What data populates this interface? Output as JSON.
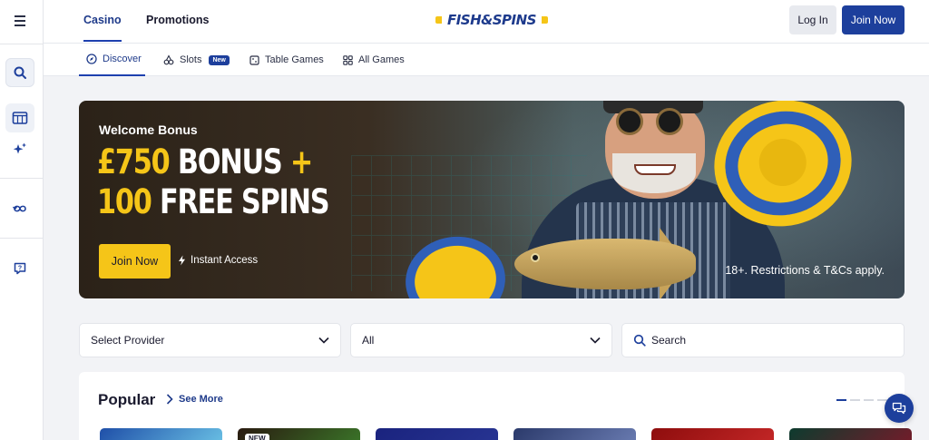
{
  "header": {
    "tabs": [
      {
        "label": "Casino",
        "active": true
      },
      {
        "label": "Promotions",
        "active": false
      }
    ],
    "logo_text": "FISH&SPINS",
    "login_label": "Log In",
    "join_label": "Join Now"
  },
  "subnav": {
    "items": [
      {
        "label": "Discover",
        "icon": "compass-icon",
        "active": true
      },
      {
        "label": "Slots",
        "icon": "cherries-icon",
        "badge": "New"
      },
      {
        "label": "Table Games",
        "icon": "table-icon"
      },
      {
        "label": "All Games",
        "icon": "grid-icon"
      }
    ]
  },
  "sidebar": {
    "icons": [
      "menu-icon",
      "search-icon",
      "slot-machine-icon",
      "sparkle-icon",
      "loop-icon",
      "help-icon"
    ]
  },
  "banner": {
    "eyebrow": "Welcome Bonus",
    "line1_gold": "£750",
    "line1_white": "BONUS",
    "line1_plus": "+",
    "line2_gold": "100",
    "line2_white": "FREE SPINS",
    "cta_label": "Join Now",
    "instant_label": "Instant Access",
    "terms": "18+. Restrictions & T&Cs apply."
  },
  "filters": {
    "provider_value": "Select Provider",
    "category_value": "All",
    "search_placeholder": "Search"
  },
  "popular": {
    "title": "Popular",
    "see_more": "See More",
    "carousel_page": 1,
    "carousel_pages": 4,
    "thumbnails": [
      {
        "colors": [
          "#1f4fa8",
          "#6ec7e8"
        ],
        "badge": ""
      },
      {
        "colors": [
          "#2a1a10",
          "#3b7a2a"
        ],
        "badge": "NEW"
      },
      {
        "colors": [
          "#1a237e",
          "#283593"
        ],
        "badge": ""
      },
      {
        "colors": [
          "#2b3a6b",
          "#6d7fb5"
        ],
        "badge": ""
      },
      {
        "colors": [
          "#8e0d0d",
          "#c62828"
        ],
        "badge": ""
      },
      {
        "colors": [
          "#0d3b2e",
          "#7a1a2a"
        ],
        "badge": ""
      }
    ]
  },
  "colors": {
    "brand_blue": "#1d3f9c",
    "accent_gold": "#f5c518"
  }
}
